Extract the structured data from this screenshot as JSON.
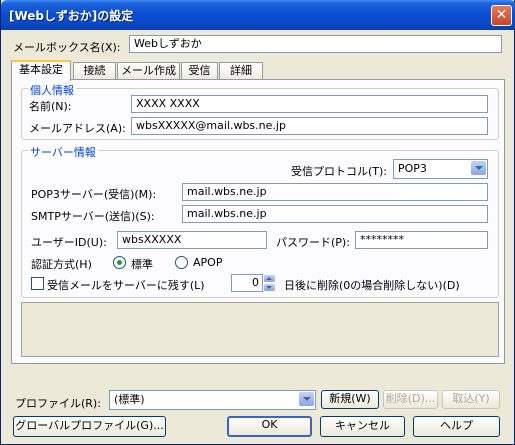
{
  "window": {
    "title": "[Webしずおか]の設定",
    "close_label": "✕"
  },
  "mailbox": {
    "name_label": "メールボックス名(X):",
    "name_value": "Webしずおか"
  },
  "tabs": [
    {
      "label": "基本設定",
      "active": true
    },
    {
      "label": "接続",
      "active": false
    },
    {
      "label": "メール作成",
      "active": false
    },
    {
      "label": "受信",
      "active": false
    },
    {
      "label": "詳細",
      "active": false
    }
  ],
  "personal": {
    "group_title": "個人情報",
    "name_label": "名前(N):",
    "name_value": "XXXX XXXX",
    "address_label": "メールアドレス(A):",
    "address_value": "wbsXXXXX@mail.wbs.ne.jp"
  },
  "server": {
    "group_title": "サーバー情報",
    "protocol_label": "受信プロトコル(T):",
    "protocol_value": "POP3",
    "pop3_label": "POP3サーバー(受信)(M):",
    "pop3_value": "mail.wbs.ne.jp",
    "smtp_label": "SMTPサーバー(送信)(S):",
    "smtp_value": "mail.wbs.ne.jp",
    "userid_label": "ユーザーID(U):",
    "userid_value": "wbsXXXXX",
    "password_label": "パスワード(P):",
    "password_value": "********",
    "auth_label": "認証方式(H)",
    "auth_options": [
      {
        "label": "標準",
        "selected": true
      },
      {
        "label": "APOP",
        "selected": false
      }
    ],
    "leave_on_server_label": "受信メールをサーバーに残す(L)",
    "leave_on_server_checked": false,
    "delete_days_value": "0",
    "delete_after_label": "日後に削除(0の場合削除しない)(D)"
  },
  "footer": {
    "profile_label": "プロファイル(R):",
    "profile_value": "(標準)",
    "new_button": "新規(W)",
    "delete_button": "削除(D)...",
    "import_button": "取込(Y)",
    "global_profile_button": "グローバルプロファイル(G)...",
    "ok_button": "OK",
    "cancel_button": "キャンセル",
    "help_button": "ヘルプ"
  }
}
